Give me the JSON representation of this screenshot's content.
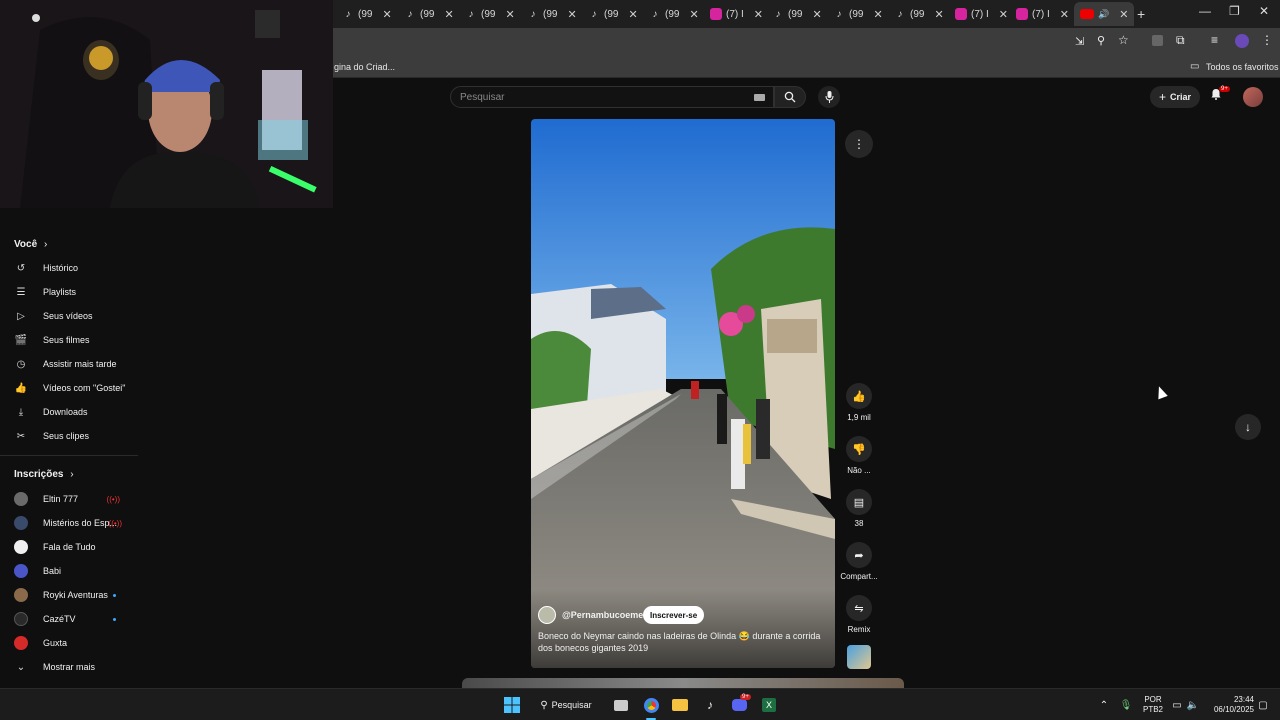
{
  "browser": {
    "tabs": [
      {
        "icon": "tiktok-icon",
        "label": "(99"
      },
      {
        "icon": "tiktok-icon",
        "label": "(99"
      },
      {
        "icon": "tiktok-icon",
        "label": "(99"
      },
      {
        "icon": "tiktok-icon",
        "label": "(99"
      },
      {
        "icon": "tiktok-icon",
        "label": "(99"
      },
      {
        "icon": "tiktok-icon",
        "label": "(99"
      },
      {
        "icon": "instagram-icon",
        "label": "(7) I"
      },
      {
        "icon": "tiktok-icon",
        "label": "(99"
      },
      {
        "icon": "tiktok-icon",
        "label": "(99"
      },
      {
        "icon": "tiktok-icon",
        "label": "(99"
      },
      {
        "icon": "instagram-icon",
        "label": "(7) I"
      },
      {
        "icon": "instagram-icon",
        "label": "(7) I"
      }
    ],
    "active_tab_icon": "youtube-icon",
    "new_tab_label": "+",
    "bookmark_partial": "gina do Criad...",
    "bookmarks_all": "Todos os favoritos"
  },
  "header": {
    "search_placeholder": "Pesquisar",
    "create_label": "Criar",
    "notifications_badge": "9+"
  },
  "sidebar": {
    "you_title": "Você",
    "you_items": [
      {
        "icon": "history-icon",
        "label": "Histórico"
      },
      {
        "icon": "playlists-icon",
        "label": "Playlists"
      },
      {
        "icon": "your-videos-icon",
        "label": "Seus vídeos"
      },
      {
        "icon": "movies-icon",
        "label": "Seus filmes"
      },
      {
        "icon": "watch-later-icon",
        "label": "Assistir mais tarde"
      },
      {
        "icon": "liked-icon",
        "label": "Vídeos com \"Gostei\""
      },
      {
        "icon": "download-icon",
        "label": "Downloads"
      },
      {
        "icon": "clips-icon",
        "label": "Seus clipes"
      }
    ],
    "subs_title": "Inscrições",
    "subs": [
      {
        "label": "Eltin 777",
        "status": "live",
        "color": "#6a6a6a"
      },
      {
        "label": "Mistérios do Esp...",
        "status": "live",
        "color": "#3a4a6a"
      },
      {
        "label": "Fala de Tudo",
        "status": "none",
        "color": "#f0f0f0"
      },
      {
        "label": "Babi",
        "status": "none",
        "color": "#4a56c8"
      },
      {
        "label": "Royki Aventuras",
        "status": "new",
        "color": "#8a6a4a"
      },
      {
        "label": "CazéTV",
        "status": "new",
        "color": "#2a2a2a"
      },
      {
        "label": "Guxta",
        "status": "none",
        "color": "#d42a2a"
      }
    ],
    "show_more": "Mostrar mais"
  },
  "short": {
    "channel": "@Pernambucoemeu",
    "subscribe": "Inscrever-se",
    "title_part1": "Boneco do Neymar caindo nas ladeiras de Olinda",
    "title_emoji": "😂",
    "title_part2": "durante a corrida dos bonecos gigantes 2019",
    "actions": {
      "likes": "1,9 mil",
      "dislike": "Não ...",
      "comments": "38",
      "share": "Compart...",
      "remix": "Remix"
    }
  },
  "taskbar": {
    "search_label": "Pesquisar",
    "lang1": "POR",
    "lang2": "PTB2",
    "time": "23:44",
    "date": "06/10/2025",
    "discord_badge": "9+"
  }
}
